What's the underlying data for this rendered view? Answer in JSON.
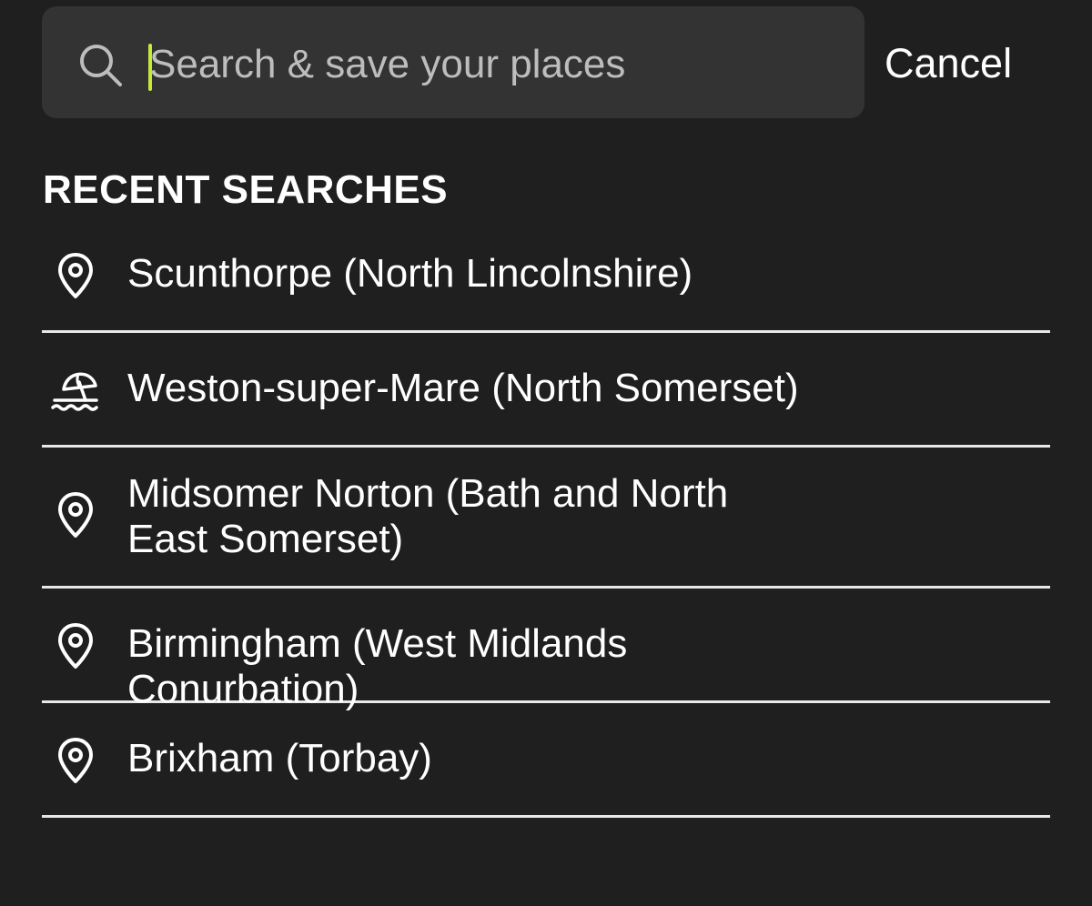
{
  "search": {
    "placeholder": "Search & save your places",
    "value": "",
    "cancel_label": "Cancel",
    "caret_color": "#c6e83a"
  },
  "recent": {
    "heading": "RECENT SEARCHES",
    "items": [
      {
        "label": "Scunthorpe (North Lincolnshire)",
        "icon": "location-pin-icon"
      },
      {
        "label": "Weston-super-Mare (North Somerset)",
        "icon": "beach-umbrella-icon"
      },
      {
        "label": "Midsomer Norton (Bath and North East Somerset)",
        "icon": "location-pin-icon"
      },
      {
        "label": "Birmingham (West Midlands Conurbation)",
        "icon": "location-pin-icon"
      },
      {
        "label": "Brixham (Torbay)",
        "icon": "location-pin-icon"
      }
    ]
  },
  "colors": {
    "background": "#1f1f1f",
    "search_box": "#333333",
    "divider": "#e8e8e8",
    "text": "#ffffff"
  }
}
